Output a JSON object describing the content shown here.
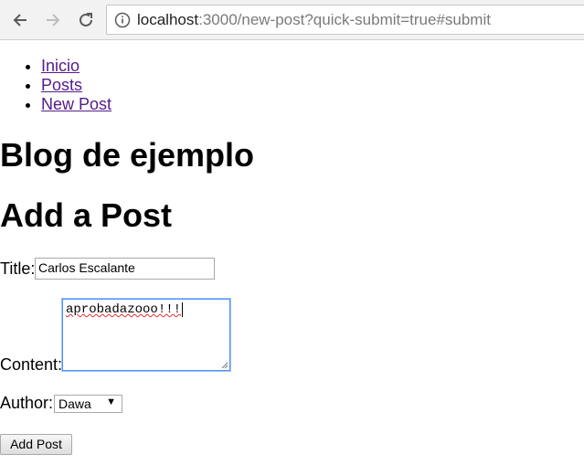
{
  "browser": {
    "url_host": "localhost",
    "url_path": ":3000/new-post?quick-submit=true#submit",
    "icons": {
      "back": "arrow-left-icon",
      "forward": "arrow-right-icon",
      "reload": "reload-icon",
      "info": "info-icon"
    }
  },
  "nav": {
    "items": [
      {
        "label": "Inicio"
      },
      {
        "label": "Posts"
      },
      {
        "label": "New Post"
      }
    ]
  },
  "page": {
    "site_title": "Blog de ejemplo",
    "form_title": "Add a Post"
  },
  "form": {
    "title_label": "Title:",
    "title_value": "Carlos Escalante",
    "content_label": "Content:",
    "content_value": "aprobadazooo!!!",
    "author_label": "Author:",
    "author_selected": "Dawa",
    "submit_label": "Add Post"
  },
  "colors": {
    "link_visited": "#551a8b",
    "focus_border": "#4d90fe",
    "spellcheck": "#e03030"
  }
}
